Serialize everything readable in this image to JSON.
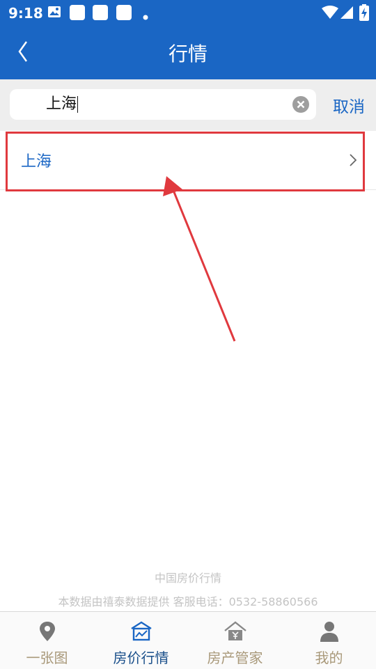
{
  "status_bar": {
    "time": "9:18"
  },
  "header": {
    "title": "行情"
  },
  "search": {
    "value": "上海",
    "cancel_label": "取消"
  },
  "results": [
    {
      "label": "上海"
    }
  ],
  "footer": {
    "line1": "中国房价行情",
    "line2": "本数据由禧泰数据提供 客服电话：0532-58860566"
  },
  "tabs": [
    {
      "label": "一张图",
      "icon": "map-pin-icon"
    },
    {
      "label": "房价行情",
      "icon": "house-chart-icon",
      "active": true
    },
    {
      "label": "房产管家",
      "icon": "house-yen-icon"
    },
    {
      "label": "我的",
      "icon": "person-icon"
    }
  ],
  "colors": {
    "primary": "#1a66c4",
    "highlight": "#e0393e",
    "tab_inactive": "#a9997a",
    "tab_active": "#1a4f8a"
  }
}
